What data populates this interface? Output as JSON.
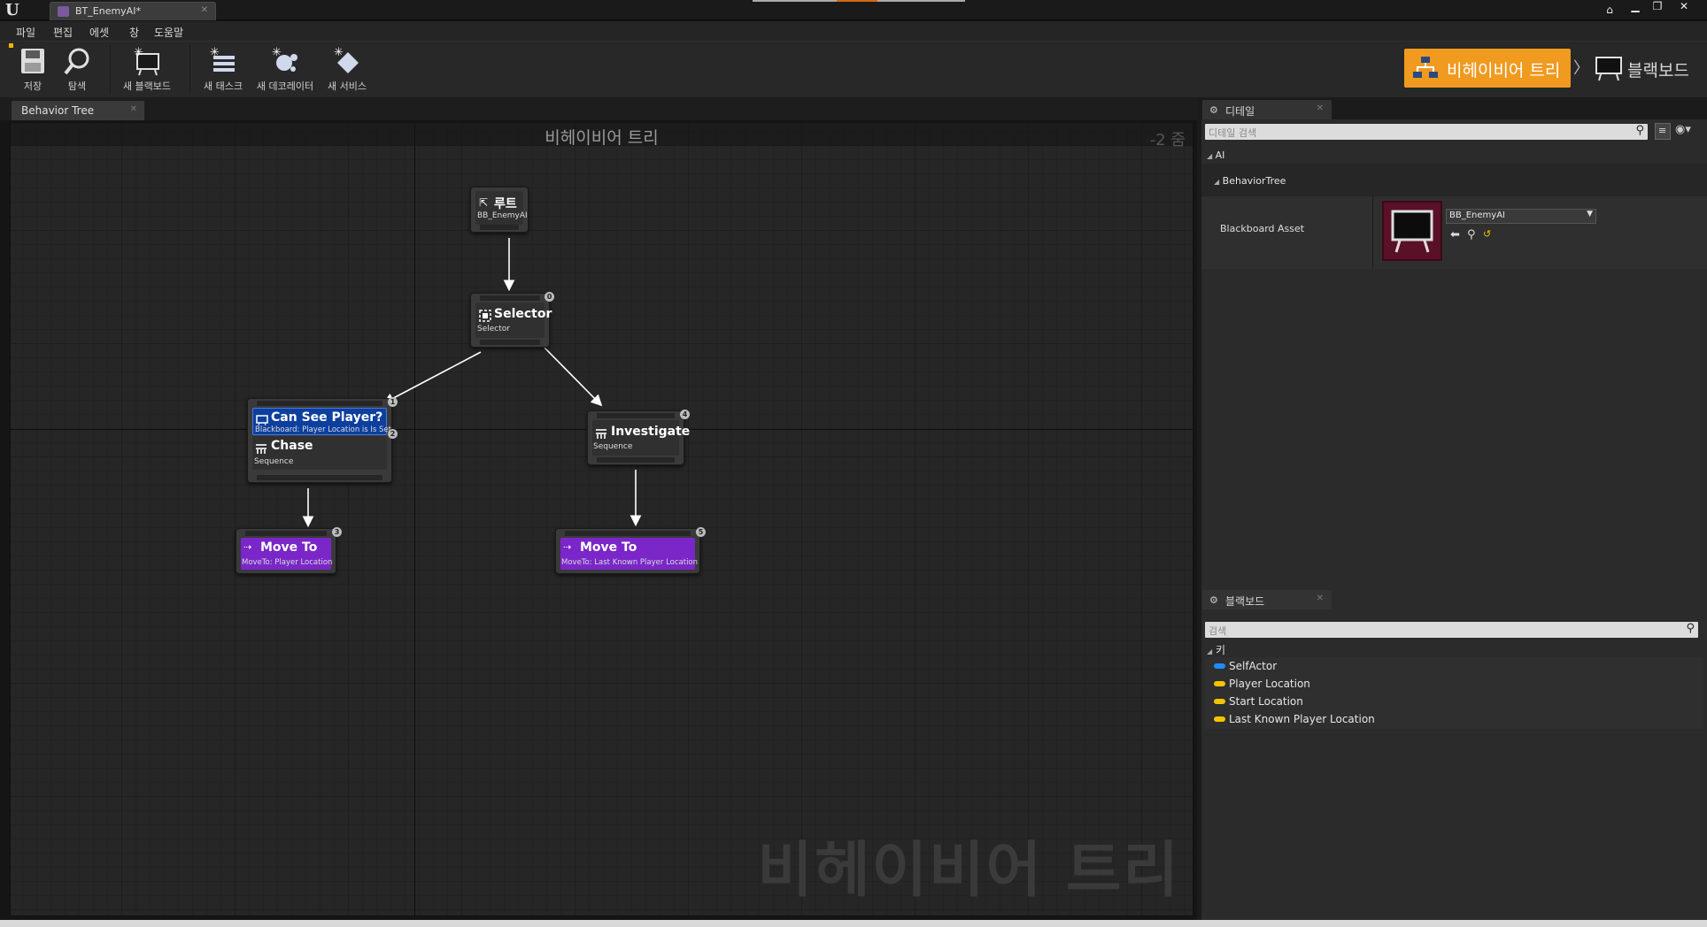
{
  "window": {
    "doc_tab": "BT_EnemyAI*",
    "min": "▁",
    "max": "❐",
    "close": "✕"
  },
  "menu": [
    "파일",
    "편집",
    "에셋",
    "창",
    "도움말"
  ],
  "toolbar": {
    "save": "저장",
    "browse": "탐색",
    "new_blackboard": "새 블랙보드",
    "new_task": "새 태스크",
    "new_decorator": "새 데코레이터",
    "new_service": "새 서비스"
  },
  "modes": {
    "behavior_tree": "비헤이비어 트리",
    "blackboard": "블랙보드",
    "chevron": "〉"
  },
  "graph": {
    "tab": "Behavior Tree",
    "title": "비헤이비어 트리",
    "zoom": "-2 줌",
    "watermark": "비헤이비어 트리",
    "nodes": {
      "root": {
        "title": "루트",
        "sub": "BB_EnemyAI"
      },
      "selector": {
        "title": "Selector",
        "sub": "Selector",
        "index": "0"
      },
      "chase": {
        "decorator_title": "Can See Player?",
        "decorator_sub": "Blackboard: Player Location is Is Set",
        "decorator_index": "2",
        "title": "Chase",
        "sub": "Sequence",
        "index": "1"
      },
      "investigate": {
        "title": "Investigate",
        "sub": "Sequence",
        "index": "4"
      },
      "moveto_player": {
        "title": "Move To",
        "sub": "MoveTo: Player Location",
        "index": "3"
      },
      "moveto_last": {
        "title": "Move To",
        "sub": "MoveTo: Last Known Player Location",
        "index": "5"
      }
    }
  },
  "details": {
    "tab": "디테일",
    "search_placeholder": "디테일 검색",
    "category": "AI",
    "subcategory": "BehaviorTree",
    "property_label": "Blackboard Asset",
    "property_value": "BB_EnemyAI"
  },
  "blackboard": {
    "tab": "블랙보드",
    "search_placeholder": "검색",
    "keys_header": "키",
    "keys": [
      {
        "name": "SelfActor",
        "color": "#1e8cff"
      },
      {
        "name": "Player Location",
        "color": "#f5c400"
      },
      {
        "name": "Start Location",
        "color": "#f5c400"
      },
      {
        "name": "Last Known Player Location",
        "color": "#f5c400"
      }
    ]
  },
  "colors": {
    "mode_active": "#f09a20",
    "decorator": "#0d3f9e",
    "task": "#7a26c8"
  }
}
